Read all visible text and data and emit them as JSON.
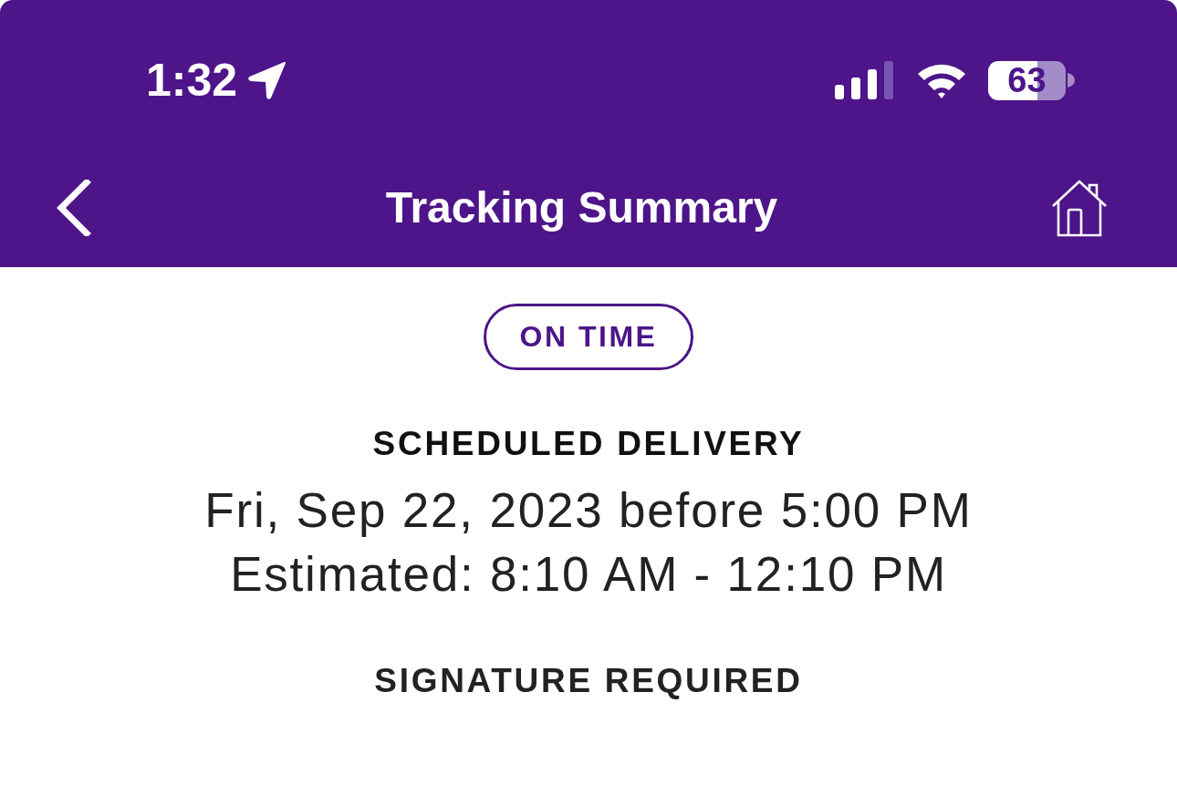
{
  "status_bar": {
    "time": "1:32",
    "battery": "63"
  },
  "nav_bar": {
    "title": "Tracking Summary"
  },
  "status_badge": {
    "label": "ON TIME"
  },
  "delivery": {
    "heading": "SCHEDULED DELIVERY",
    "date": "Fri, Sep 22, 2023 before 5:00 PM",
    "estimate": "Estimated: 8:10 AM - 12:10 PM"
  },
  "signature": {
    "label": "SIGNATURE REQUIRED"
  }
}
